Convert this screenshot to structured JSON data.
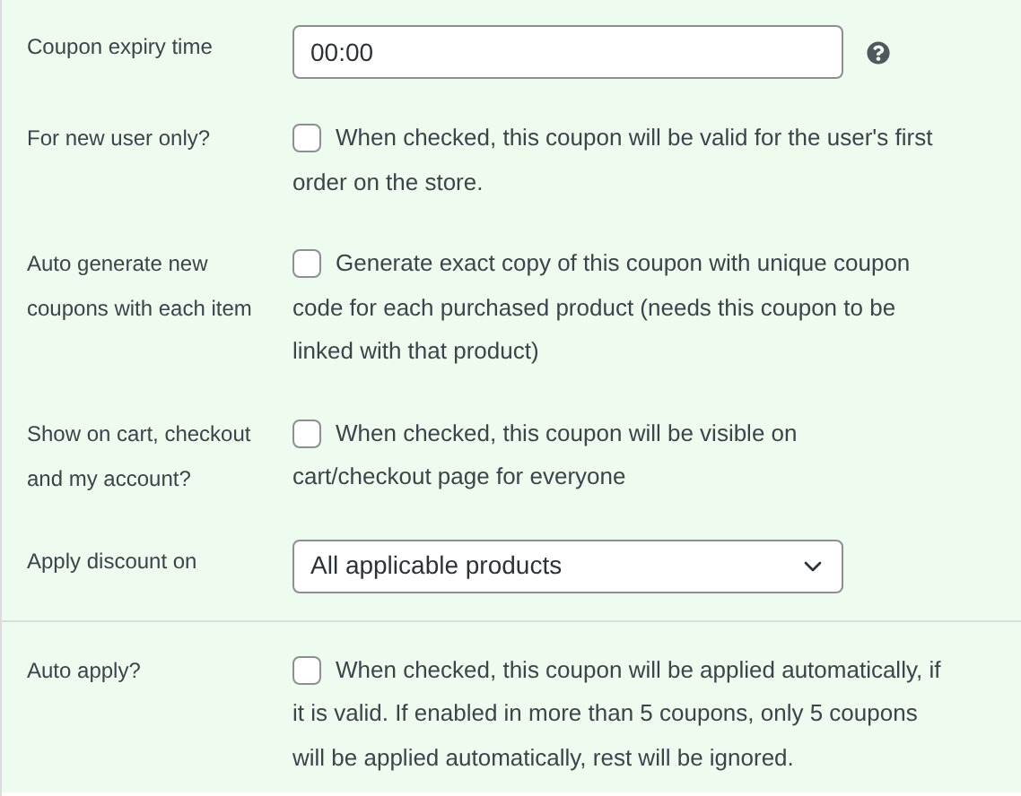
{
  "sections": [
    {
      "rows": [
        {
          "kind": "time",
          "label": "Coupon expiry time",
          "value": "00:00",
          "help": true
        },
        {
          "kind": "checkbox",
          "label": "For new user only?",
          "checked": false,
          "description": "When checked, this coupon will be valid for the user's first order on the store."
        },
        {
          "kind": "checkbox",
          "label": "Auto generate new coupons with each item",
          "checked": false,
          "description": "Generate exact copy of this coupon with unique coupon code for each purchased product (needs this coupon to be linked with that product)"
        },
        {
          "kind": "checkbox",
          "label": "Show on cart, checkout and my account?",
          "checked": false,
          "description": "When checked, this coupon will be visible on cart/checkout page for everyone"
        },
        {
          "kind": "select",
          "label": "Apply discount on",
          "value": "All applicable products"
        }
      ]
    },
    {
      "rows": [
        {
          "kind": "checkbox",
          "label": "Auto apply?",
          "checked": false,
          "description": "When checked, this coupon will be applied automatically, if it is valid. If enabled in more than 5 coupons, only 5 coupons will be applied automatically, rest will be ignored."
        }
      ]
    }
  ]
}
